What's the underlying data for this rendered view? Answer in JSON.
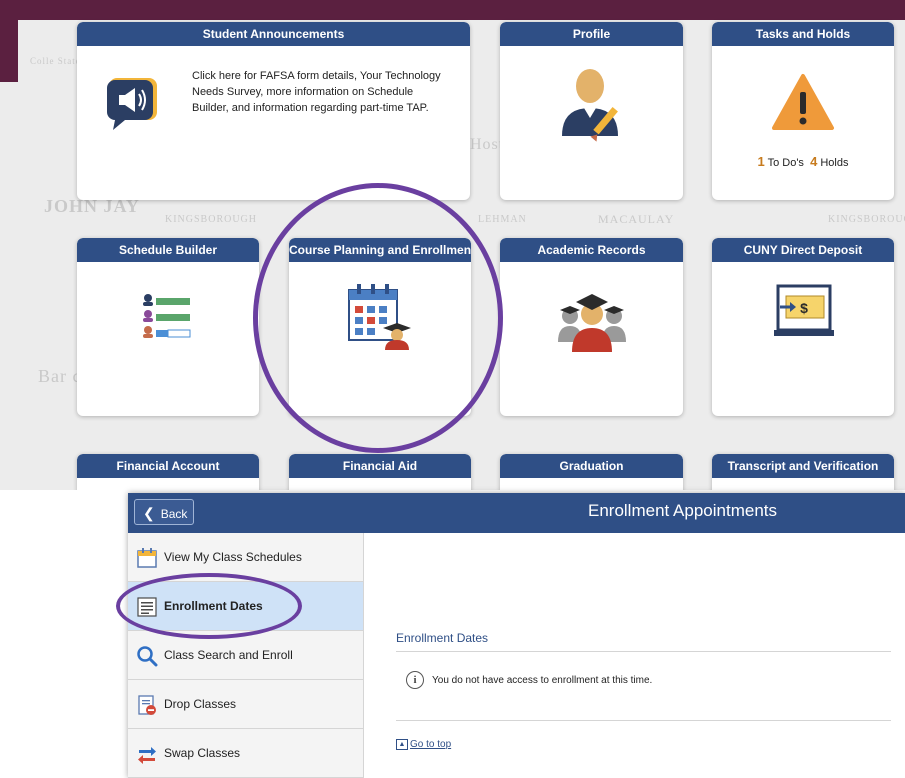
{
  "dashboard": {
    "watermarks": [
      "Colle Staten",
      "JOHN JAY",
      "KINGSBOROUGH",
      "LEHMAN",
      "MACAULAY",
      "KINGSBOROUGH",
      "Bar colle",
      "Host"
    ],
    "tiles": {
      "announcements": {
        "title": "Student Announcements",
        "text": "Click here for FAFSA form details, Your Technology Needs Survey, more information on Schedule Builder, and information regarding part-time TAP."
      },
      "profile": {
        "title": "Profile"
      },
      "tasks": {
        "title": "Tasks and Holds",
        "todo_count": "1",
        "todo_label": "To Do's",
        "holds_count": "4",
        "holds_label": "Holds"
      },
      "schedule_builder": {
        "title": "Schedule Builder"
      },
      "course_planning": {
        "title": "Course Planning and Enrollment"
      },
      "academic_records": {
        "title": "Academic Records"
      },
      "direct_deposit": {
        "title": "CUNY Direct Deposit"
      },
      "financial_account": {
        "title": "Financial Account"
      },
      "financial_aid": {
        "title": "Financial Aid"
      },
      "graduation": {
        "title": "Graduation"
      },
      "transcript": {
        "title": "Transcript and Verification"
      }
    }
  },
  "enrollment": {
    "back_label": "Back",
    "page_title": "Enrollment Appointments",
    "nav": [
      {
        "label": "View My Class Schedules",
        "icon": "calendar-icon"
      },
      {
        "label": "Enrollment Dates",
        "icon": "list-icon",
        "active": true
      },
      {
        "label": "Class Search and Enroll",
        "icon": "search-icon"
      },
      {
        "label": "Drop Classes",
        "icon": "drop-icon"
      },
      {
        "label": "Swap Classes",
        "icon": "swap-icon"
      }
    ],
    "section_title": "Enrollment Dates",
    "message": "You do not have access to enrollment at this time.",
    "info_glyph": "i",
    "go_to_top": "Go to top"
  },
  "colors": {
    "header_blue": "#2f4f86",
    "brand_maroon": "#5b2040",
    "highlight_purple": "#6a3fa0",
    "active_nav": "#cfe2f7",
    "accent_orange": "#c77b1e"
  }
}
